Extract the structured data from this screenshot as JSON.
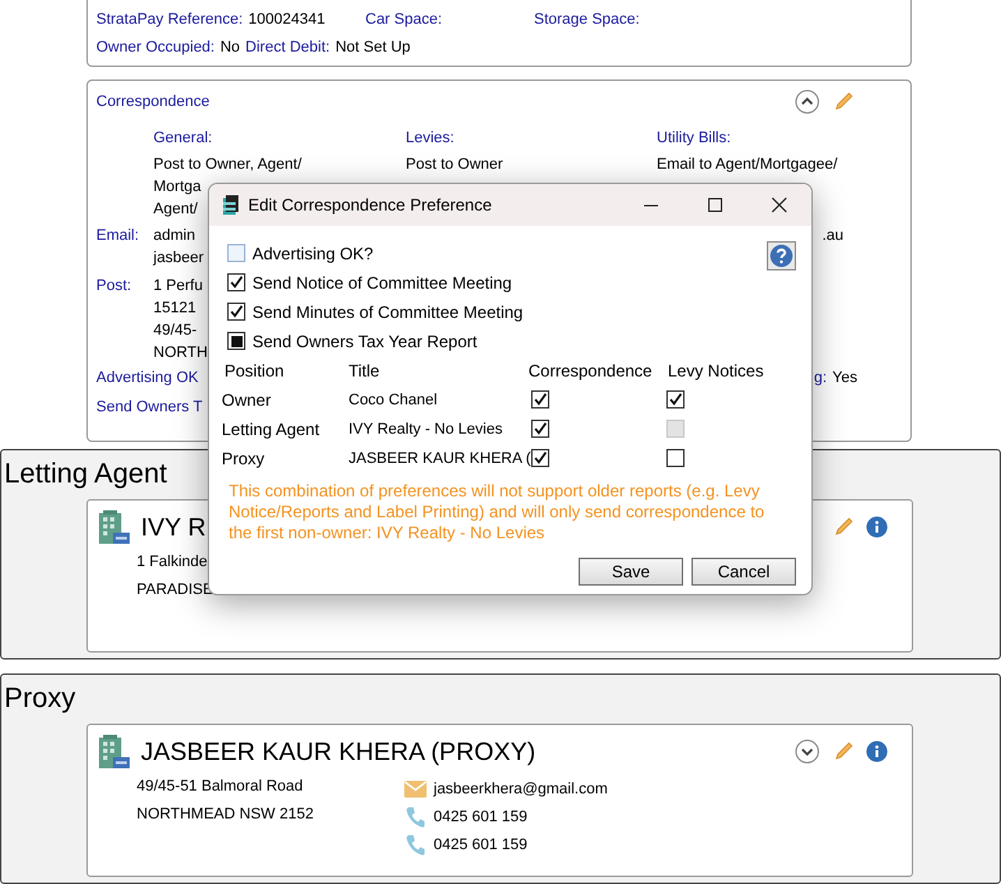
{
  "summary": {
    "rows": [
      [
        {
          "label": "StrataPay Reference:",
          "value": "100024341"
        },
        {
          "label": "Car Space:"
        },
        {
          "label": "Storage Space:"
        }
      ],
      [
        {
          "label": "Owner Occupied:",
          "value": "No"
        },
        {
          "label": "Direct Debit:",
          "value": "Not Set Up"
        }
      ]
    ]
  },
  "correspondence": {
    "title": "Correspondence",
    "expanded": true,
    "columns": [
      {
        "label": "General:",
        "lines": [
          "Post to Owner, Agent/",
          "Mortga",
          "Agent/"
        ]
      },
      {
        "label": "Levies:",
        "lines": [
          "Post to Owner"
        ]
      },
      {
        "label": "Utility Bills:",
        "lines": [
          "Email to Agent/Mortgagee/"
        ]
      }
    ],
    "email": {
      "label": "Email:",
      "lines": [
        "admin",
        "jasbeer"
      ],
      "right": ".au"
    },
    "post": {
      "label": "Post:",
      "lines": [
        "1 Perfu",
        "15121",
        "49/45-",
        "NORTH"
      ]
    },
    "advertising": {
      "label": "Advertising OK",
      "right_label": "g:",
      "right_value": "Yes"
    },
    "send_owners": "Send Owners T"
  },
  "sections": [
    {
      "heading": "Letting Agent",
      "name": "IVY R",
      "address": [
        "1 Falkinde",
        "PARADISE"
      ]
    },
    {
      "heading": "Proxy",
      "name": "JASBEER KAUR KHERA (PROXY)",
      "expanded": false,
      "address": [
        "49/45-51 Balmoral Road",
        "NORTHMEAD NSW 2152"
      ],
      "contacts": [
        {
          "kind": "email",
          "text": "jasbeerkhera@gmail.com"
        },
        {
          "kind": "phone",
          "text": "0425 601 159"
        },
        {
          "kind": "phone",
          "text": "0425 601 159"
        }
      ]
    }
  ],
  "dialog": {
    "title": "Edit Correspondence Preference",
    "options": [
      {
        "label": "Advertising OK?",
        "checked": false,
        "indeterminate": false
      },
      {
        "label": "Send Notice of Committee Meeting",
        "checked": true,
        "indeterminate": false
      },
      {
        "label": "Send Minutes of Committee Meeting",
        "checked": true,
        "indeterminate": false
      },
      {
        "label": "Send Owners Tax Year Report",
        "checked": true,
        "indeterminate": true
      }
    ],
    "columns": [
      "Position",
      "Title",
      "Correspondence",
      "Levy Notices"
    ],
    "rows": [
      {
        "position": "Owner",
        "title": "Coco Chanel",
        "correspondence": {
          "checked": true,
          "disabled": false
        },
        "levy_notices": {
          "checked": true,
          "disabled": false
        }
      },
      {
        "position": "Letting Agent",
        "title": "IVY Realty - No Levies",
        "correspondence": {
          "checked": true,
          "disabled": false
        },
        "levy_notices": {
          "checked": false,
          "disabled": true
        }
      },
      {
        "position": "Proxy",
        "title": "JASBEER KAUR KHERA (",
        "correspondence": {
          "checked": true,
          "disabled": false
        },
        "levy_notices": {
          "checked": false,
          "disabled": false
        }
      }
    ],
    "warning": "This combination of preferences will not support older reports (e.g. Levy Notice/Reports and Label Printing) and will only send correspondence to the first non-owner: IVY Realty - No Levies",
    "buttons": [
      "Save",
      "Cancel"
    ]
  }
}
